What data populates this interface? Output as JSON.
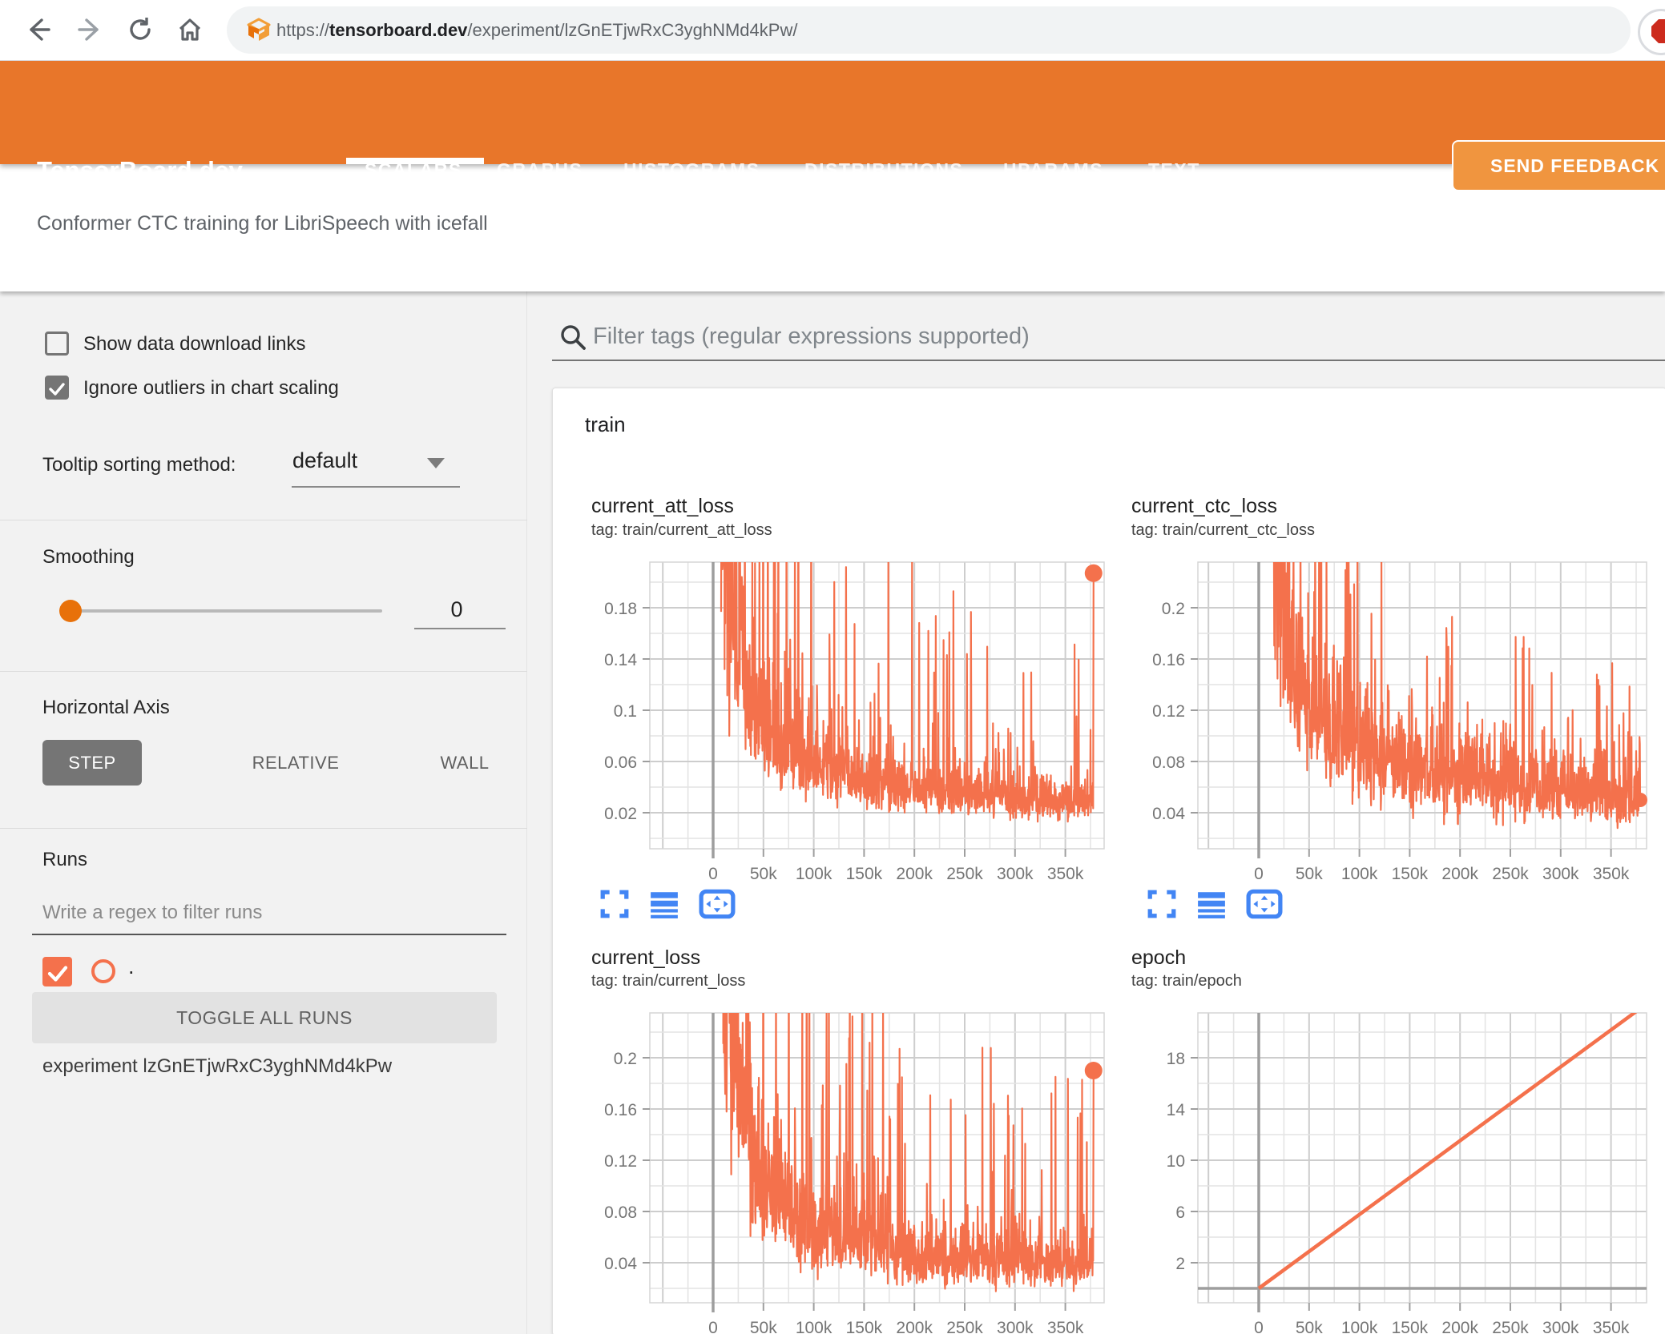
{
  "browser": {
    "url_scheme": "https://",
    "url_domain": "tensorboard.dev",
    "url_path": "/experiment/lzGnETjwRxC3yghNMd4kPw/"
  },
  "header": {
    "brand": "TensorBoard.dev",
    "tabs": [
      {
        "label": "SCALARS",
        "active": true
      },
      {
        "label": "GRAPHS",
        "active": false
      },
      {
        "label": "HISTOGRAMS",
        "active": false
      },
      {
        "label": "DISTRIBUTIONS",
        "active": false
      },
      {
        "label": "HPARAMS",
        "active": false
      },
      {
        "label": "TEXT",
        "active": false
      }
    ],
    "feedback": "SEND FEEDBACK",
    "header_color": "#e8762a",
    "feedback_button_color": "#f0953f"
  },
  "subtitle": "Conformer CTC training for LibriSpeech with icefall",
  "sidebar": {
    "show_download": "Show data download links",
    "show_download_checked": false,
    "ignore_outliers": "Ignore outliers in chart scaling",
    "ignore_outliers_checked": true,
    "tooltip_label": "Tooltip sorting method:",
    "tooltip_value": "default",
    "smoothing_label": "Smoothing",
    "smoothing_value": "0",
    "haxis_label": "Horizontal Axis",
    "haxis": [
      "STEP",
      "RELATIVE",
      "WALL"
    ],
    "haxis_selected": "STEP",
    "runs_label": "Runs",
    "runs_placeholder": "Write a regex to filter runs",
    "run_checked": true,
    "run_name": ".",
    "toggle_all": "TOGGLE ALL RUNS",
    "experiment": "experiment lzGnETjwRxC3yghNMd4kPw"
  },
  "main": {
    "filter_placeholder": "Filter tags (regular expressions supported)",
    "group": "train"
  },
  "colors": {
    "series": "#f4714c",
    "toolbar_icon_blue": "#4285f4",
    "grid_major": "#cdcdcd",
    "grid_minor": "#e4e4e4",
    "axis_dark": "#9e9e9e",
    "tick_text": "#757575",
    "slider_thumb_orange": "#e8710a"
  },
  "chart_data": [
    {
      "type": "line",
      "title": "current_att_loss",
      "tag": "tag: train/current_att_loss",
      "xlabel": "step",
      "x_ticks": [
        {
          "v": 0,
          "label": "0"
        },
        {
          "v": 50000,
          "label": "50k"
        },
        {
          "v": 100000,
          "label": "100k"
        },
        {
          "v": 150000,
          "label": "150k"
        },
        {
          "v": 200000,
          "label": "200k"
        },
        {
          "v": 250000,
          "label": "250k"
        },
        {
          "v": 300000,
          "label": "300k"
        },
        {
          "v": 350000,
          "label": "350k"
        }
      ],
      "y_ticks": [
        {
          "v": 0.02,
          "label": "0.02"
        },
        {
          "v": 0.06,
          "label": "0.06"
        },
        {
          "v": 0.1,
          "label": "0.1"
        },
        {
          "v": 0.14,
          "label": "0.14"
        },
        {
          "v": 0.18,
          "label": "0.18"
        }
      ],
      "x_minor_step": 25000,
      "x_major_step": 50000,
      "y_minor_step": 0.02,
      "ylim": [
        0,
        0.216
      ],
      "xlim": [
        -63000,
        388000
      ],
      "trend": [
        [
          8000,
          0.26
        ],
        [
          20000,
          0.17
        ],
        [
          40000,
          0.1
        ],
        [
          70000,
          0.072
        ],
        [
          100000,
          0.058
        ],
        [
          150000,
          0.045
        ],
        [
          200000,
          0.038
        ],
        [
          250000,
          0.034
        ],
        [
          300000,
          0.031
        ],
        [
          350000,
          0.028
        ],
        [
          383000,
          0.028
        ]
      ],
      "noise": 0.3,
      "spike_prob": 0.05,
      "spike_range": [
        1.8,
        5.8
      ],
      "floor": 0.013,
      "seed": 42,
      "n_points": 1100,
      "end_dot": {
        "x": 378000,
        "y": 0.207,
        "r": 11
      }
    },
    {
      "type": "line",
      "title": "current_ctc_loss",
      "tag": "tag: train/current_ctc_loss",
      "xlabel": "step",
      "x_ticks": [
        {
          "v": 0,
          "label": "0"
        },
        {
          "v": 50000,
          "label": "50k"
        },
        {
          "v": 100000,
          "label": "100k"
        },
        {
          "v": 150000,
          "label": "150k"
        },
        {
          "v": 200000,
          "label": "200k"
        },
        {
          "v": 250000,
          "label": "250k"
        },
        {
          "v": 300000,
          "label": "300k"
        },
        {
          "v": 350000,
          "label": "350k"
        }
      ],
      "y_ticks": [
        {
          "v": 0.04,
          "label": "0.04"
        },
        {
          "v": 0.08,
          "label": "0.08"
        },
        {
          "v": 0.12,
          "label": "0.12"
        },
        {
          "v": 0.16,
          "label": "0.16"
        },
        {
          "v": 0.2,
          "label": "0.2"
        }
      ],
      "x_minor_step": 25000,
      "x_major_step": 50000,
      "y_minor_step": 0.02,
      "ylim": [
        0.012,
        0.2356
      ],
      "xlim": [
        -60500,
        385000
      ],
      "trend": [
        [
          15000,
          0.26
        ],
        [
          30000,
          0.17
        ],
        [
          50000,
          0.13
        ],
        [
          80000,
          0.1
        ],
        [
          120000,
          0.085
        ],
        [
          160000,
          0.075
        ],
        [
          200000,
          0.068
        ],
        [
          250000,
          0.062
        ],
        [
          300000,
          0.058
        ],
        [
          350000,
          0.053
        ],
        [
          380000,
          0.05
        ]
      ],
      "noise": 0.27,
      "spike_prob": 0.045,
      "spike_range": [
        1.5,
        3.0
      ],
      "floor": 0.02,
      "seed": 7,
      "n_points": 1100,
      "end_dot": {
        "x": 379000,
        "y": 0.05,
        "r": 9
      }
    },
    {
      "type": "line",
      "title": "current_loss",
      "tag": "tag: train/current_loss",
      "xlabel": "step",
      "x_ticks": [
        {
          "v": 0,
          "label": "0"
        },
        {
          "v": 50000,
          "label": "50k"
        },
        {
          "v": 100000,
          "label": "100k"
        },
        {
          "v": 150000,
          "label": "150k"
        },
        {
          "v": 200000,
          "label": "200k"
        },
        {
          "v": 250000,
          "label": "250k"
        },
        {
          "v": 300000,
          "label": "300k"
        },
        {
          "v": 350000,
          "label": "350k"
        }
      ],
      "y_ticks": [
        {
          "v": 0.04,
          "label": "0.04"
        },
        {
          "v": 0.08,
          "label": "0.08"
        },
        {
          "v": 0.12,
          "label": "0.12"
        },
        {
          "v": 0.16,
          "label": "0.16"
        },
        {
          "v": 0.2,
          "label": "0.2"
        }
      ],
      "x_minor_step": 25000,
      "x_major_step": 50000,
      "y_minor_step": 0.02,
      "ylim": [
        0.009,
        0.235
      ],
      "xlim": [
        -63000,
        388000
      ],
      "trend": [
        [
          10000,
          0.27
        ],
        [
          25000,
          0.16
        ],
        [
          50000,
          0.1
        ],
        [
          80000,
          0.075
        ],
        [
          120000,
          0.06
        ],
        [
          160000,
          0.052
        ],
        [
          200000,
          0.045
        ],
        [
          250000,
          0.042
        ],
        [
          300000,
          0.04
        ],
        [
          350000,
          0.036
        ],
        [
          378000,
          0.04
        ]
      ],
      "noise": 0.3,
      "spike_prob": 0.05,
      "spike_range": [
        1.8,
        5.2
      ],
      "floor": 0.014,
      "seed": 13,
      "n_points": 1100,
      "end_dot": {
        "x": 378000,
        "y": 0.19,
        "r": 11
      }
    },
    {
      "type": "line",
      "title": "epoch",
      "tag": "tag: train/epoch",
      "xlabel": "step",
      "x_ticks": [
        {
          "v": 0,
          "label": "0"
        },
        {
          "v": 50000,
          "label": "50k"
        },
        {
          "v": 100000,
          "label": "100k"
        },
        {
          "v": 150000,
          "label": "150k"
        },
        {
          "v": 200000,
          "label": "200k"
        },
        {
          "v": 250000,
          "label": "250k"
        },
        {
          "v": 300000,
          "label": "300k"
        },
        {
          "v": 350000,
          "label": "350k"
        }
      ],
      "y_ticks": [
        {
          "v": 2,
          "label": "2"
        },
        {
          "v": 6,
          "label": "6"
        },
        {
          "v": 10,
          "label": "10"
        },
        {
          "v": 14,
          "label": "14"
        },
        {
          "v": 18,
          "label": "18"
        }
      ],
      "x_minor_step": 25000,
      "x_major_step": 50000,
      "y_minor_step": 2,
      "ylim": [
        -1.125,
        21.5
      ],
      "xlim": [
        -60500,
        385000
      ],
      "line_points": [
        [
          0,
          0
        ],
        [
          380000,
          21.9
        ]
      ],
      "zero_baseline": true,
      "stroke_width": 4.5,
      "end_dot": null
    }
  ]
}
